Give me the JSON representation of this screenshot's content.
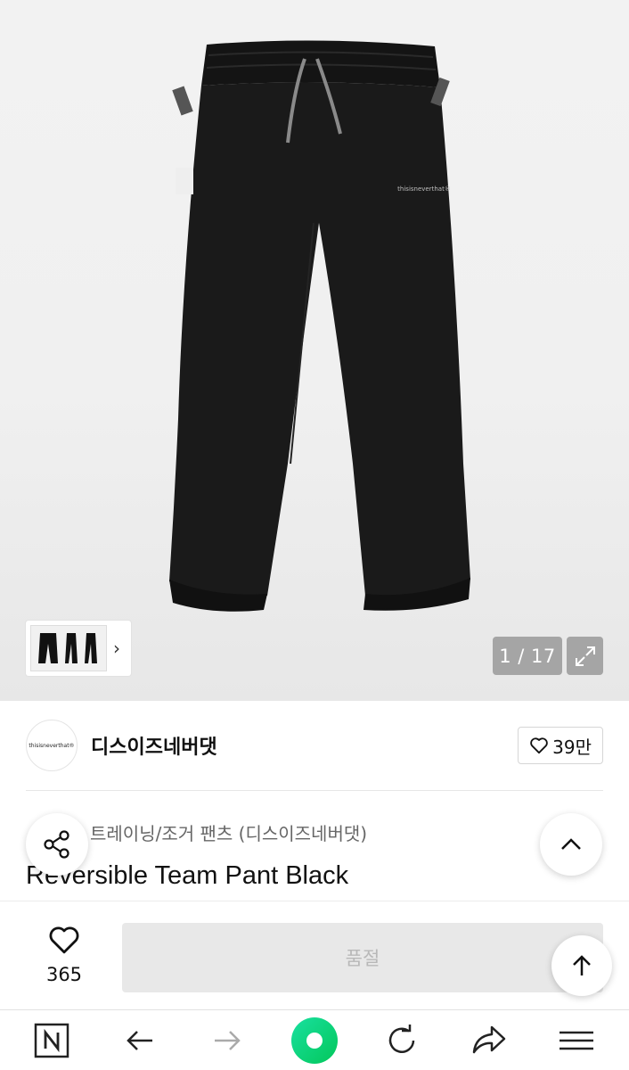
{
  "gallery": {
    "counter": "1 / 17",
    "brand_print": "thisisneverthat®"
  },
  "seller": {
    "logo_text": "thisisneverthat®",
    "name": "디스이즈네버댓",
    "likes": "39만"
  },
  "product": {
    "category": "트레이닝/조거 팬츠 (디스이즈네버댓)",
    "title": "Reversible Team Pant Black"
  },
  "purchase": {
    "wish_count": "365",
    "buy_label": "품절"
  },
  "colors": {
    "accent_green": "#03c75a"
  }
}
